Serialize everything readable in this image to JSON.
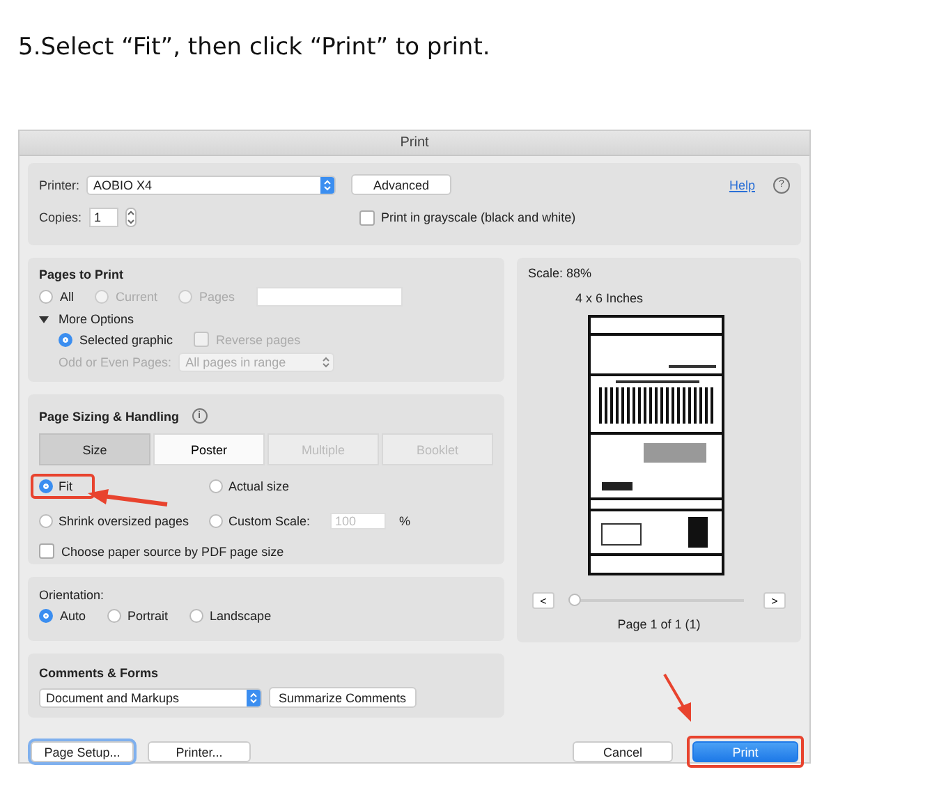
{
  "instruction": "5.Select “Fit”, then click “Print” to print.",
  "window": {
    "title": "Print"
  },
  "printer": {
    "label": "Printer:",
    "value": "AOBIO X4",
    "advanced": "Advanced",
    "help": "Help",
    "help_icon": "?"
  },
  "copies": {
    "label": "Copies:",
    "value": "1"
  },
  "grayscale": {
    "label": "Print in grayscale (black and white)",
    "checked": false
  },
  "pages_to_print": {
    "title": "Pages to Print",
    "options": [
      {
        "label": "All",
        "selected": false,
        "disabled": false
      },
      {
        "label": "Current",
        "selected": false,
        "disabled": true
      },
      {
        "label": "Pages",
        "selected": false,
        "disabled": true
      }
    ],
    "more_options": {
      "label": "More Options",
      "expanded": true
    },
    "selected_graphic": {
      "label": "Selected graphic",
      "selected": true
    },
    "reverse_pages": {
      "label": "Reverse pages",
      "checked": false,
      "disabled": true
    },
    "odd_even": {
      "label": "Odd or Even Pages:",
      "value": "All pages in range",
      "disabled": true
    }
  },
  "page_sizing": {
    "title": "Page Sizing & Handling",
    "info_icon": "i",
    "tabs": [
      {
        "label": "Size",
        "selected": true,
        "disabled": false
      },
      {
        "label": "Poster",
        "selected": false,
        "disabled": false
      },
      {
        "label": "Multiple",
        "selected": false,
        "disabled": true
      },
      {
        "label": "Booklet",
        "selected": false,
        "disabled": true
      }
    ],
    "options": [
      {
        "label": "Fit",
        "selected": true,
        "highlighted": true
      },
      {
        "label": "Actual size",
        "selected": false,
        "highlighted": false
      },
      {
        "label": "Shrink oversized pages",
        "selected": false,
        "highlighted": false
      },
      {
        "label": "Custom Scale:",
        "selected": false,
        "highlighted": false
      }
    ],
    "custom_scale": {
      "placeholder": "100",
      "unit": "%"
    },
    "paper_source": {
      "label": "Choose paper source by PDF page size",
      "checked": false
    }
  },
  "orientation": {
    "label": "Orientation:",
    "options": [
      {
        "label": "Auto",
        "selected": true
      },
      {
        "label": "Portrait",
        "selected": false
      },
      {
        "label": "Landscape",
        "selected": false
      }
    ]
  },
  "comments_forms": {
    "title": "Comments & Forms",
    "value": "Document and Markups",
    "summarize": "Summarize Comments"
  },
  "preview": {
    "scale": "Scale:  88%",
    "paper": "4 x 6 Inches",
    "prev": "<",
    "next": ">",
    "slider": {
      "level": 0
    },
    "page": "Page 1 of 1 (1)"
  },
  "footer": {
    "left": [
      {
        "label": "Page Setup...",
        "kind": "focused"
      },
      {
        "label": "Printer...",
        "kind": "plain"
      }
    ],
    "cancel": "Cancel",
    "print": {
      "label": "Print",
      "highlighted": true
    }
  }
}
